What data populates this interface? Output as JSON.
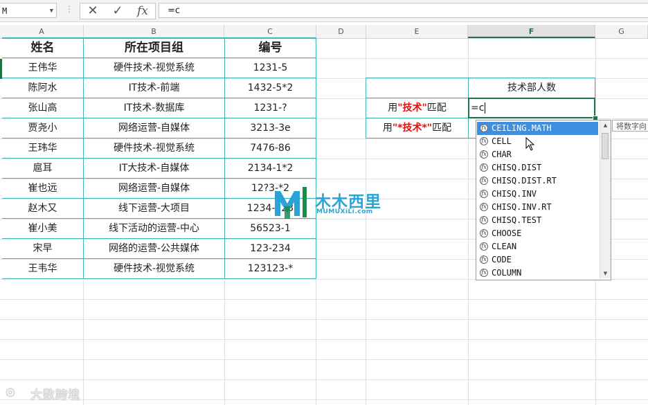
{
  "formula_bar": {
    "name_box": "M",
    "formula": "=c",
    "cancel_glyph": "✕",
    "enter_glyph": "✓",
    "fx_label": "fx"
  },
  "columns": [
    "A",
    "B",
    "C",
    "D",
    "E",
    "F",
    "G"
  ],
  "selected_column": "F",
  "table": {
    "headers": [
      "姓名",
      "所在项目组",
      "编号"
    ],
    "rows": [
      [
        "王伟华",
        "硬件技术-视觉系统",
        "1231-5"
      ],
      [
        "陈阿水",
        "IT技术-前端",
        "1432-5*2"
      ],
      [
        "张山高",
        "IT技术-数据库",
        "1231-?"
      ],
      [
        "贾尧小",
        "网络运营-自媒体",
        "3213-3e"
      ],
      [
        "王玮华",
        "硬件技术-视觉系统",
        "7476-86"
      ],
      [
        "扈耳",
        "IT大技术-自媒体",
        "2134-1*2"
      ],
      [
        "崔也远",
        "网络运营-自媒体",
        "12?3-*2"
      ],
      [
        "赵木又",
        "线下运营-大项目",
        "1234-123"
      ],
      [
        "崔小美",
        "线下活动的运营-中心",
        "56523-1"
      ],
      [
        "宋早",
        "网络的运营-公共媒体",
        "123-234"
      ],
      [
        "王韦华",
        "硬件技术-视觉系统",
        "123123-*"
      ]
    ]
  },
  "side_table": {
    "header": "技术部人数",
    "row1": {
      "prefix": "用",
      "keyword": "\"技术\"",
      "suffix": "匹配"
    },
    "row2": {
      "prefix": "用",
      "keyword": "\"*技术*\"",
      "suffix": "匹配"
    }
  },
  "active_cell_value": "=c",
  "autocomplete": {
    "icon_label": "fx",
    "items": [
      "CEILING.MATH",
      "CELL",
      "CHAR",
      "CHISQ.DIST",
      "CHISQ.DIST.RT",
      "CHISQ.INV",
      "CHISQ.INV.RT",
      "CHISQ.TEST",
      "CHOOSE",
      "CLEAN",
      "CODE",
      "COLUMN"
    ],
    "highlighted_index": 0,
    "tooltip": "将数字向"
  },
  "watermark": {
    "logo_text": "木木西里",
    "logo_sub": "MUMUXiLi.com",
    "bottom_text": "大数跨境"
  },
  "colors": {
    "accent_green": "#217346",
    "table_border": "#3fb5b5",
    "keyword_red": "#e01010",
    "highlight_blue": "#3f8fe0"
  }
}
